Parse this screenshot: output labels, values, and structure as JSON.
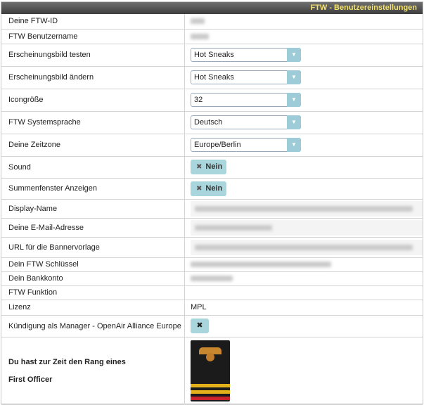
{
  "header": {
    "title": "FTW - Benutzereinstellungen"
  },
  "rows": {
    "ftw_id": {
      "label": "Deine FTW-ID"
    },
    "username": {
      "label": "FTW Benutzername"
    },
    "test_theme": {
      "label": "Erscheinungsbild testen",
      "value": "Hot Sneaks"
    },
    "change_theme": {
      "label": "Erscheinungsbild ändern",
      "value": "Hot Sneaks"
    },
    "icon_size": {
      "label": "Icongröße",
      "value": "32"
    },
    "language": {
      "label": "FTW Systemsprache",
      "value": "Deutsch"
    },
    "timezone": {
      "label": "Deine Zeitzone",
      "value": "Europe/Berlin"
    },
    "sound": {
      "label": "Sound",
      "value": "Nein"
    },
    "sum_window": {
      "label": "Summenfenster Anzeigen",
      "value": "Nein"
    },
    "display_name": {
      "label": "Display-Name"
    },
    "email": {
      "label": "Deine E-Mail-Adresse"
    },
    "banner_url": {
      "label": "URL für die Bannervorlage"
    },
    "ftw_key": {
      "label": "Dein FTW Schlüssel"
    },
    "bank": {
      "label": "Dein Bankkonto"
    },
    "function": {
      "label": "FTW Funktion"
    },
    "license": {
      "label": "Lizenz",
      "value": "MPL"
    },
    "cancel_manager": {
      "label": "Kündigung als Manager - OpenAir Alliance Europe",
      "button": "✖"
    },
    "rank": {
      "line1": "Du hast zur Zeit den Rang eines",
      "line2": "First Officer"
    }
  },
  "icons": {
    "dropdown": "chevron-down-icon",
    "toggle_off": "x-icon",
    "close": "x-icon"
  },
  "colors": {
    "header_bg": "#4a4a4a",
    "header_text": "#f5e26a",
    "button_bg": "#a9d6dc",
    "arrow_bg": "#9ecbd8"
  }
}
